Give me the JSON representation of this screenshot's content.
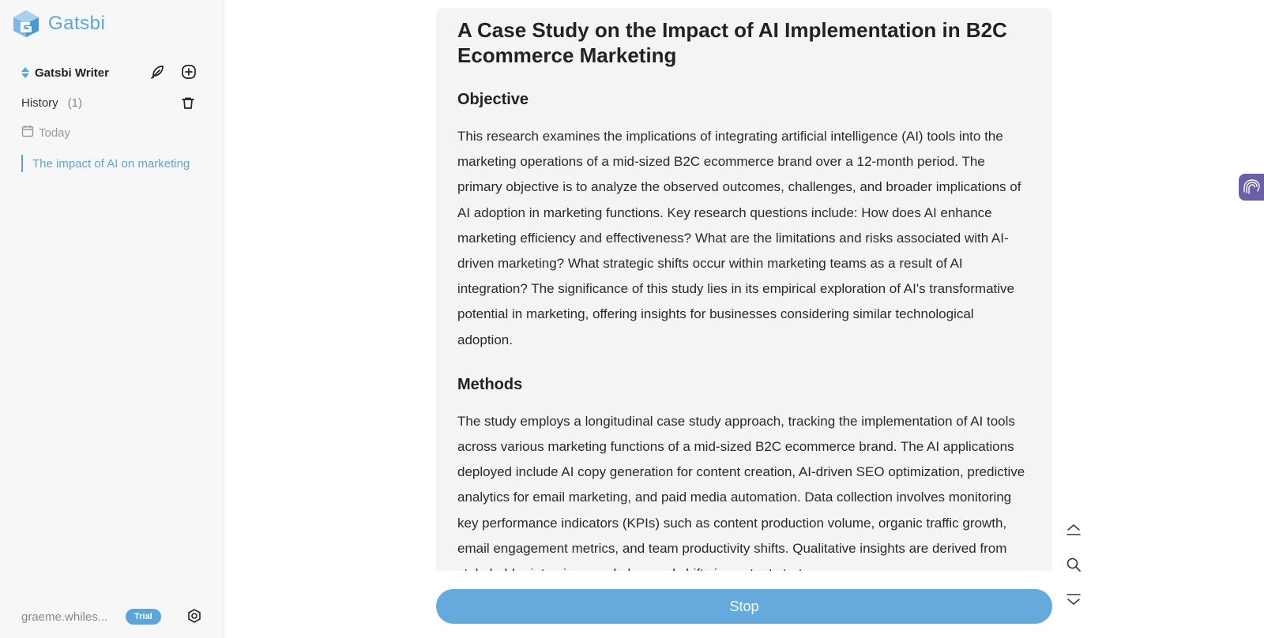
{
  "brand": {
    "name": "Gatsbi",
    "accent": "#5aa6dc"
  },
  "sidebar": {
    "writer_title": "Gatsbi Writer",
    "history_label": "History",
    "history_count": "(1)",
    "today_label": "Today",
    "history_items": [
      {
        "title": "The impact of AI on marketing"
      }
    ],
    "user_email": "graeme.whiles...",
    "plan_badge": "Trial"
  },
  "document": {
    "title": "A Case Study on the Impact of AI Implementation in B2C Ecommerce Marketing",
    "sections": [
      {
        "heading": "Objective",
        "body": "This research examines the implications of integrating artificial intelligence (AI) tools into the marketing operations of a mid-sized B2C ecommerce brand over a 12-month period. The primary objective is to analyze the observed outcomes, challenges, and broader implications of AI adoption in marketing functions. Key research questions include: How does AI enhance marketing efficiency and effectiveness? What are the limitations and risks associated with AI-driven marketing? What strategic shifts occur within marketing teams as a result of AI integration? The significance of this study lies in its empirical exploration of AI's transformative potential in marketing, offering insights for businesses considering similar technological adoption."
      },
      {
        "heading": "Methods",
        "body": "The study employs a longitudinal case study approach, tracking the implementation of AI tools across various marketing functions of a mid-sized B2C ecommerce brand. The AI applications deployed include AI copy generation for content creation, AI-driven SEO optimization, predictive analytics for email marketing, and paid media automation. Data collection involves monitoring key performance indicators (KPIs) such as content production volume, organic traffic growth, email engagement metrics, and team productivity shifts. Qualitative insights are derived from stakeholder interviews and observed shifts in content strategy."
      }
    ]
  },
  "actions": {
    "stop_label": "Stop"
  },
  "icons": {
    "logo": "gatsbi-logo-icon",
    "writer_edit": "feather-pen-icon",
    "new_chat": "plus-square-icon",
    "clear_history": "trash-icon",
    "today": "calendar-icon",
    "settings": "settings-icon",
    "scroll_top": "scroll-top-icon",
    "search": "search-icon",
    "scroll_bottom": "scroll-bottom-icon",
    "side_tab": "brain-icon"
  }
}
